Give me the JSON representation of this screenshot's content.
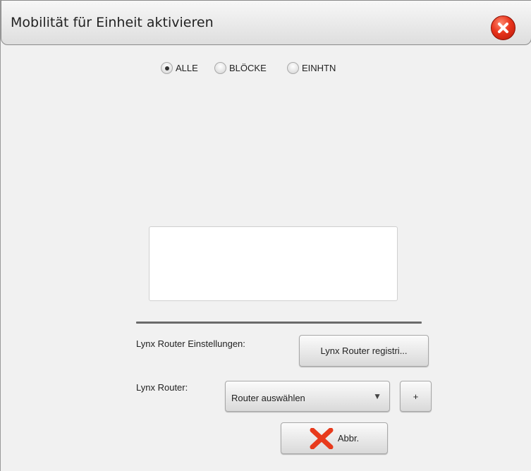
{
  "dialog": {
    "title": "Mobilität für Einheit aktivieren",
    "close_icon": "close-icon"
  },
  "scope": {
    "options": [
      {
        "label": "ALLE",
        "checked": true
      },
      {
        "label": "BLÖCKE",
        "checked": false
      },
      {
        "label": "EINHTN",
        "checked": false
      }
    ]
  },
  "list": {
    "items": []
  },
  "router": {
    "settings_label": "Lynx Router Einstellungen:",
    "register_button": "Lynx Router registri...",
    "router_label": "Lynx Router:",
    "select_value": "Router auswählen",
    "add_button": "+"
  },
  "footer": {
    "cancel_button": "Abbr.",
    "cancel_icon": "red-x-icon"
  },
  "colors": {
    "close_red": "#e8341c",
    "cancel_red": "#e83a1c"
  }
}
